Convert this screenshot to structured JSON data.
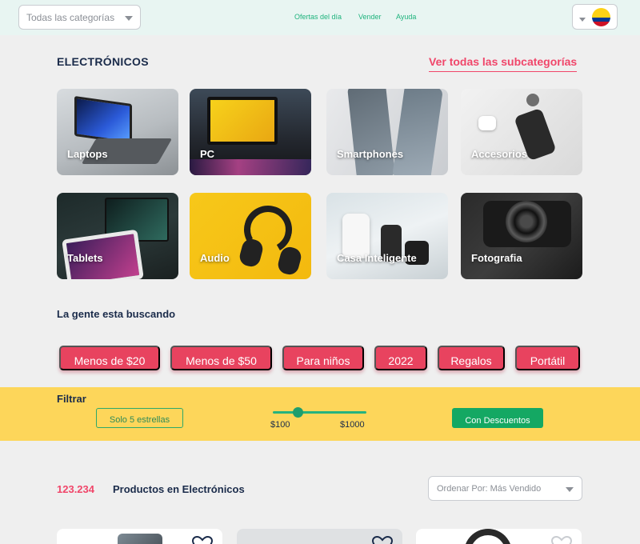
{
  "header": {
    "category_select": "Todas las categorías",
    "nav": [
      "Ofertas del día",
      "Vender",
      "Ayuda"
    ],
    "country_flag": "colombia-flag-icon"
  },
  "section": {
    "title": "ELECTRÓNICOS",
    "see_all": "Ver todas las subcategorías"
  },
  "categories": [
    {
      "label": "Laptops"
    },
    {
      "label": "PC"
    },
    {
      "label": "Smartphones"
    },
    {
      "label": "Accesorios"
    },
    {
      "label": "Tablets"
    },
    {
      "label": "Audio"
    },
    {
      "label": "Casa Inteligente"
    },
    {
      "label": "Fotografia"
    }
  ],
  "searches": {
    "title": "La gente esta buscando",
    "pills": [
      "Menos de $20",
      "Menos de $50",
      "Para niños",
      "2022",
      "Regalos",
      "Portátil"
    ]
  },
  "filter": {
    "title": "Filtrar",
    "stars_button": "Solo 5 estrellas",
    "price_min": "$100",
    "price_max": "$1000",
    "discount_button": "Con Descuentos"
  },
  "results": {
    "count": "123.234",
    "label": "Productos en Electrónicos",
    "sort": "Ordenar Por: Más Vendido"
  },
  "colors": {
    "accent_pink": "#e8435f",
    "accent_green": "#14a863",
    "filter_yellow": "#fdd65a"
  }
}
